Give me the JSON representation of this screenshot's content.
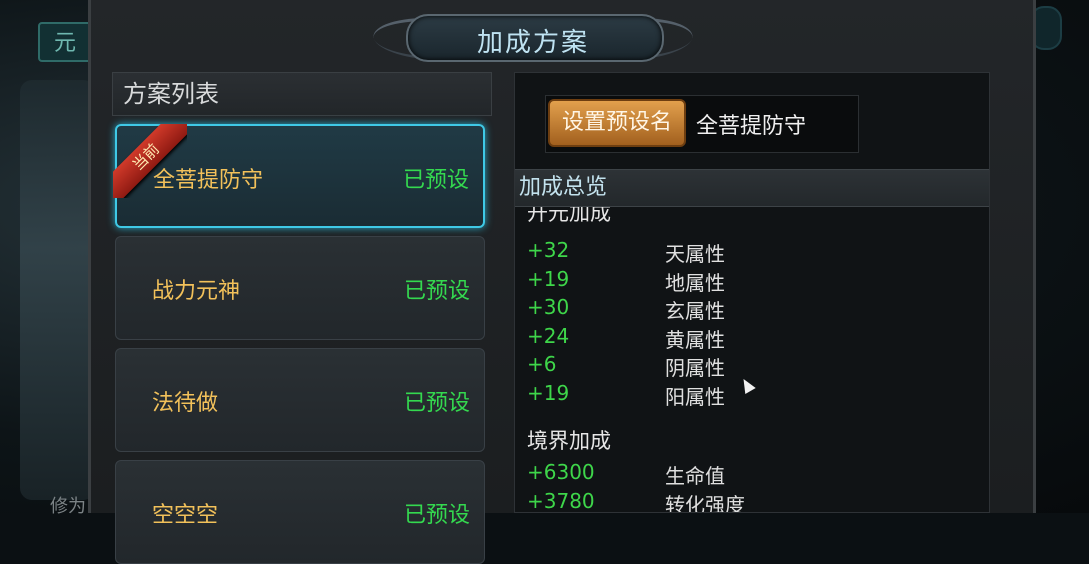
{
  "background": {
    "tab_label": "元",
    "bottom_text": "修为"
  },
  "dialog": {
    "title": "加成方案"
  },
  "list_panel": {
    "header": "方案列表",
    "current_badge": "当前",
    "items": [
      {
        "name": "全菩提防守",
        "status": "已预设",
        "active": true
      },
      {
        "name": "战力元神",
        "status": "已预设",
        "active": false
      },
      {
        "name": "法待做",
        "status": "已预设",
        "active": false
      },
      {
        "name": "空空空",
        "status": "已预设",
        "active": false
      }
    ]
  },
  "right_panel": {
    "set_preset_button": "设置预设名",
    "preset_name": "全菩提防守",
    "overview_header": "加成总览",
    "sections": [
      {
        "title": "开元加成",
        "rows": [
          {
            "value": "+32",
            "attr": "天属性"
          },
          {
            "value": "+19",
            "attr": "地属性"
          },
          {
            "value": "+30",
            "attr": "玄属性"
          },
          {
            "value": "+24",
            "attr": "黄属性"
          },
          {
            "value": "+6",
            "attr": "阴属性"
          },
          {
            "value": "+19",
            "attr": "阳属性"
          }
        ]
      },
      {
        "title": "境界加成",
        "rows": [
          {
            "value": "+6300",
            "attr": "生命值"
          },
          {
            "value": "+3780",
            "attr": "转化强度"
          }
        ]
      }
    ]
  },
  "colors": {
    "item_name": "#f2c15a",
    "status_green": "#34d94f",
    "bonus_green": "#3ed64a",
    "active_border": "#3fc9e6",
    "button_orange": "#e2a04d"
  }
}
